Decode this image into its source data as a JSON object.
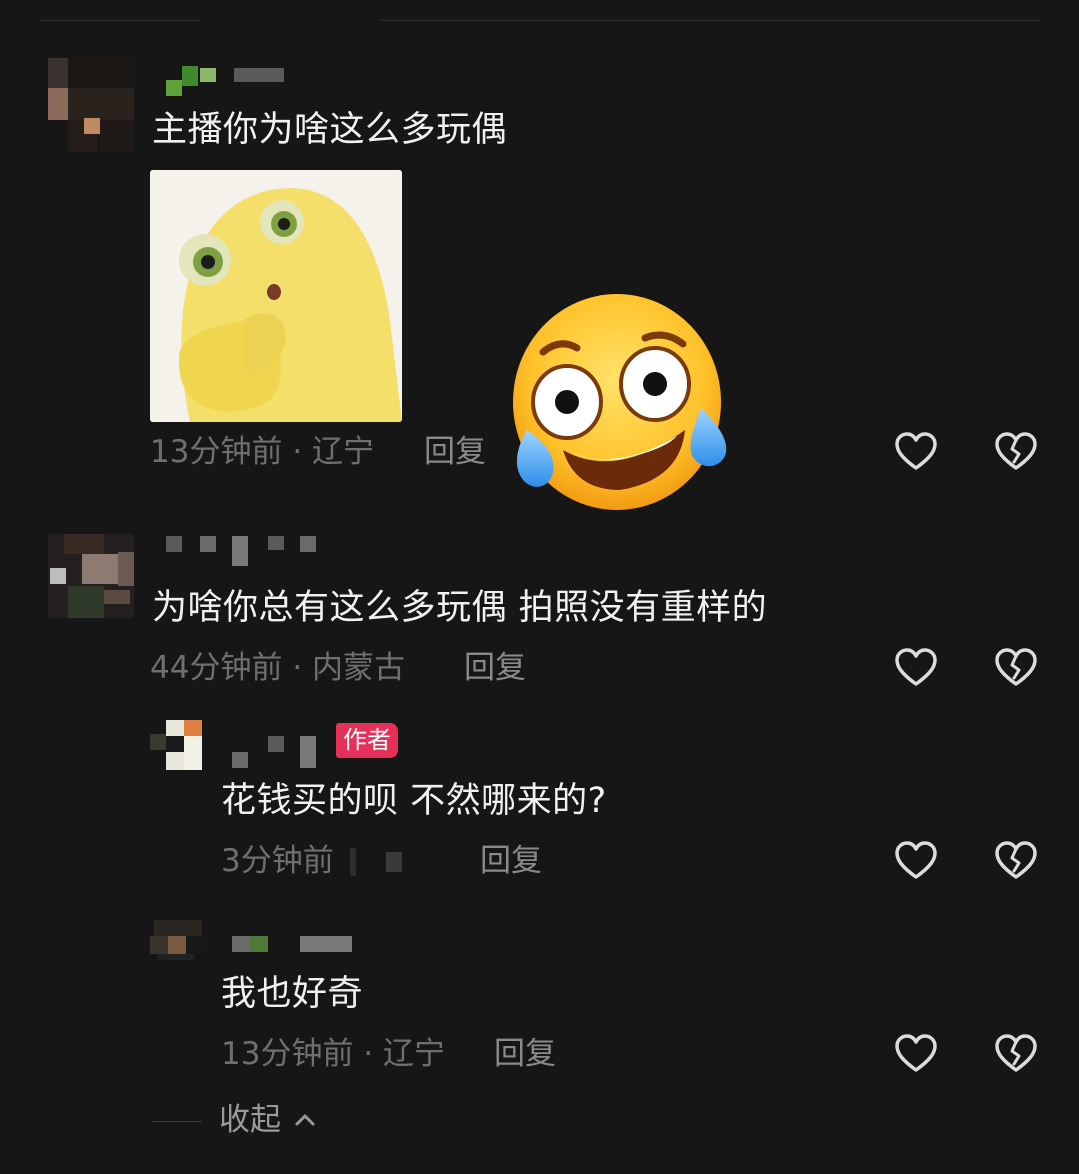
{
  "comments": [
    {
      "text": "主播你为啥这么多玩偶",
      "time": "13分钟前",
      "location": "辽宁",
      "reply_label": "回复",
      "has_sticker": true,
      "has_emoji": true
    },
    {
      "text": "为啥你总有这么多玩偶 拍照没有重样的",
      "time": "44分钟前",
      "location": "内蒙古",
      "reply_label": "回复",
      "replies": [
        {
          "text": "花钱买的呗 不然哪来的?",
          "time": "3分钟前",
          "reply_label": "回复",
          "badge": "作者"
        },
        {
          "text": "我也好奇",
          "time": "13分钟前",
          "location": "辽宁",
          "reply_label": "回复"
        }
      ]
    }
  ],
  "collapse_label": "收起",
  "separator": "·",
  "icons": {
    "like": "heart-outline-icon",
    "dislike": "broken-heart-icon",
    "collapse": "chevron-up-icon"
  },
  "colors": {
    "background": "#161616",
    "author_badge": "#e5315a",
    "meta_text": "#6f6f6f"
  }
}
